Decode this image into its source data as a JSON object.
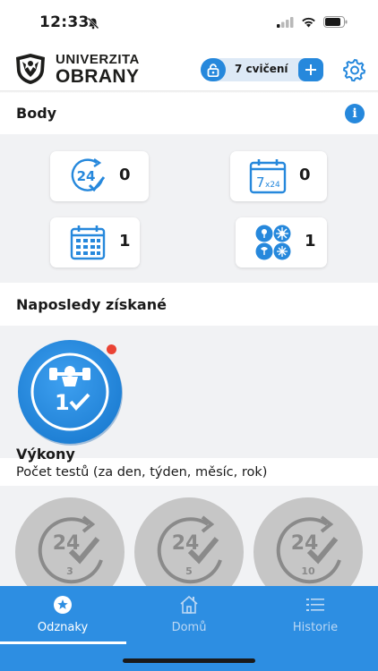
{
  "status_bar": {
    "time": "12:33"
  },
  "header": {
    "logo_line1": "UNIVERZITA",
    "logo_line2": "OBRANY",
    "exercise_count_label": "7 cvičení"
  },
  "points_section": {
    "title": "Body",
    "cards": [
      {
        "icon": "24h-icon",
        "count": "0"
      },
      {
        "icon": "7x24-calendar-icon",
        "count": "0"
      },
      {
        "icon": "calendar-icon",
        "count": "1"
      },
      {
        "icon": "four-seasons-icon",
        "count": "1"
      }
    ]
  },
  "recent_section": {
    "title": "Naposledy získané",
    "badge": {
      "icon": "strength-badge-icon",
      "number": "1",
      "has_notification": true
    }
  },
  "performance_section": {
    "title": "Výkony",
    "subtitle": "Počet testů (za den, týden, měsíc, rok)",
    "badges": [
      {
        "top": "24",
        "bottom": "3"
      },
      {
        "top": "24",
        "bottom": "5"
      },
      {
        "top": "24",
        "bottom": "10"
      }
    ]
  },
  "tabs": [
    {
      "label": "Odznaky",
      "icon": "star-badge-icon",
      "active": true
    },
    {
      "label": "Domů",
      "icon": "home-icon",
      "active": false
    },
    {
      "label": "Historie",
      "icon": "list-icon",
      "active": false
    }
  ],
  "colors": {
    "accent": "#2688dc",
    "tabbar": "#2d8ee2",
    "band": "#f1f2f4",
    "notification": "#ea4334",
    "inactive_badge": "#c6c6c6"
  }
}
